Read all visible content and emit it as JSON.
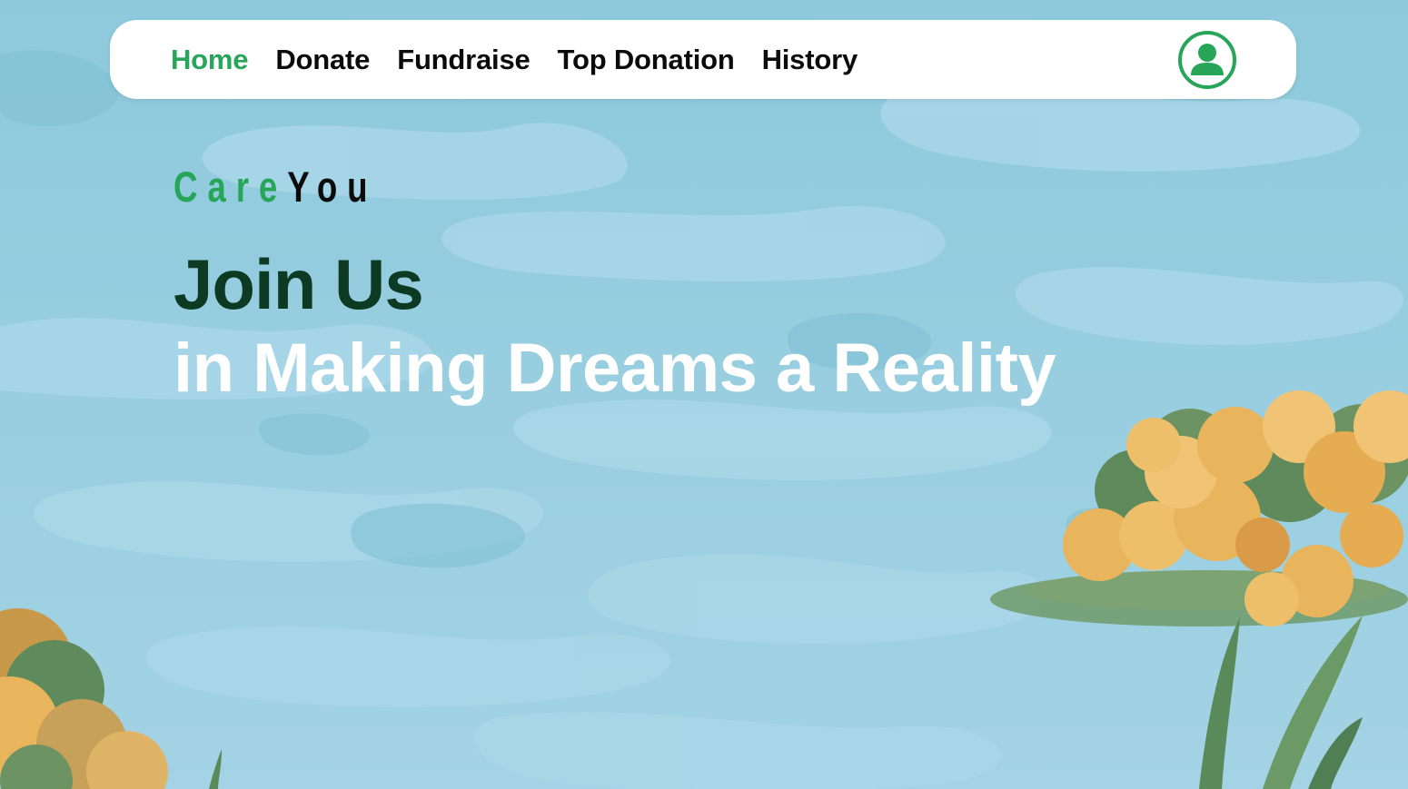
{
  "nav": {
    "items": [
      {
        "label": "Home",
        "active": true
      },
      {
        "label": "Donate",
        "active": false
      },
      {
        "label": "Fundraise",
        "active": false
      },
      {
        "label": "Top Donation",
        "active": false
      },
      {
        "label": "History",
        "active": false
      }
    ],
    "profile_icon": "user-profile-icon"
  },
  "hero": {
    "brand_part1": "Care",
    "brand_part2": "You",
    "title": "Join Us",
    "subtitle": "in Making Dreams a Reality"
  },
  "colors": {
    "accent": "#27a65a",
    "title_dark_green": "#0d3a22",
    "water": "#8fcadc",
    "foliage_orange": "#e8b45c",
    "foliage_green": "#5f8a5c"
  }
}
